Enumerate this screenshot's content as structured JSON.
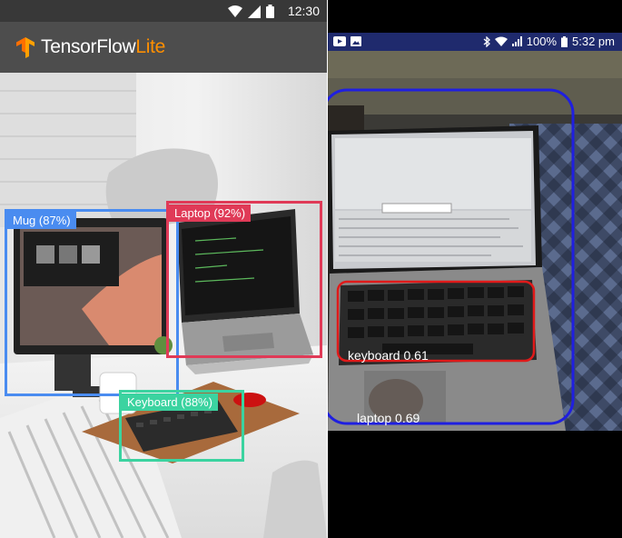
{
  "left_phone": {
    "status_bar": {
      "time": "12:30"
    },
    "app": {
      "brand_primary": "TensorFlow",
      "brand_accent": "Lite",
      "accent_color": "#ff8f00"
    },
    "detections": [
      {
        "label": "Mug (87%)",
        "color": "#4a8cf0"
      },
      {
        "label": "Laptop (92%)",
        "color": "#e03a57"
      },
      {
        "label": "Keyboard (88%)",
        "color": "#3bd3a0"
      }
    ]
  },
  "right_phone": {
    "status_bar": {
      "battery": "100%",
      "time": "5:32 pm"
    },
    "detections": [
      {
        "label": "laptop 0.69",
        "color": "#1f1fe0"
      },
      {
        "label": "keyboard 0.61",
        "color": "#e01a1a"
      }
    ]
  }
}
